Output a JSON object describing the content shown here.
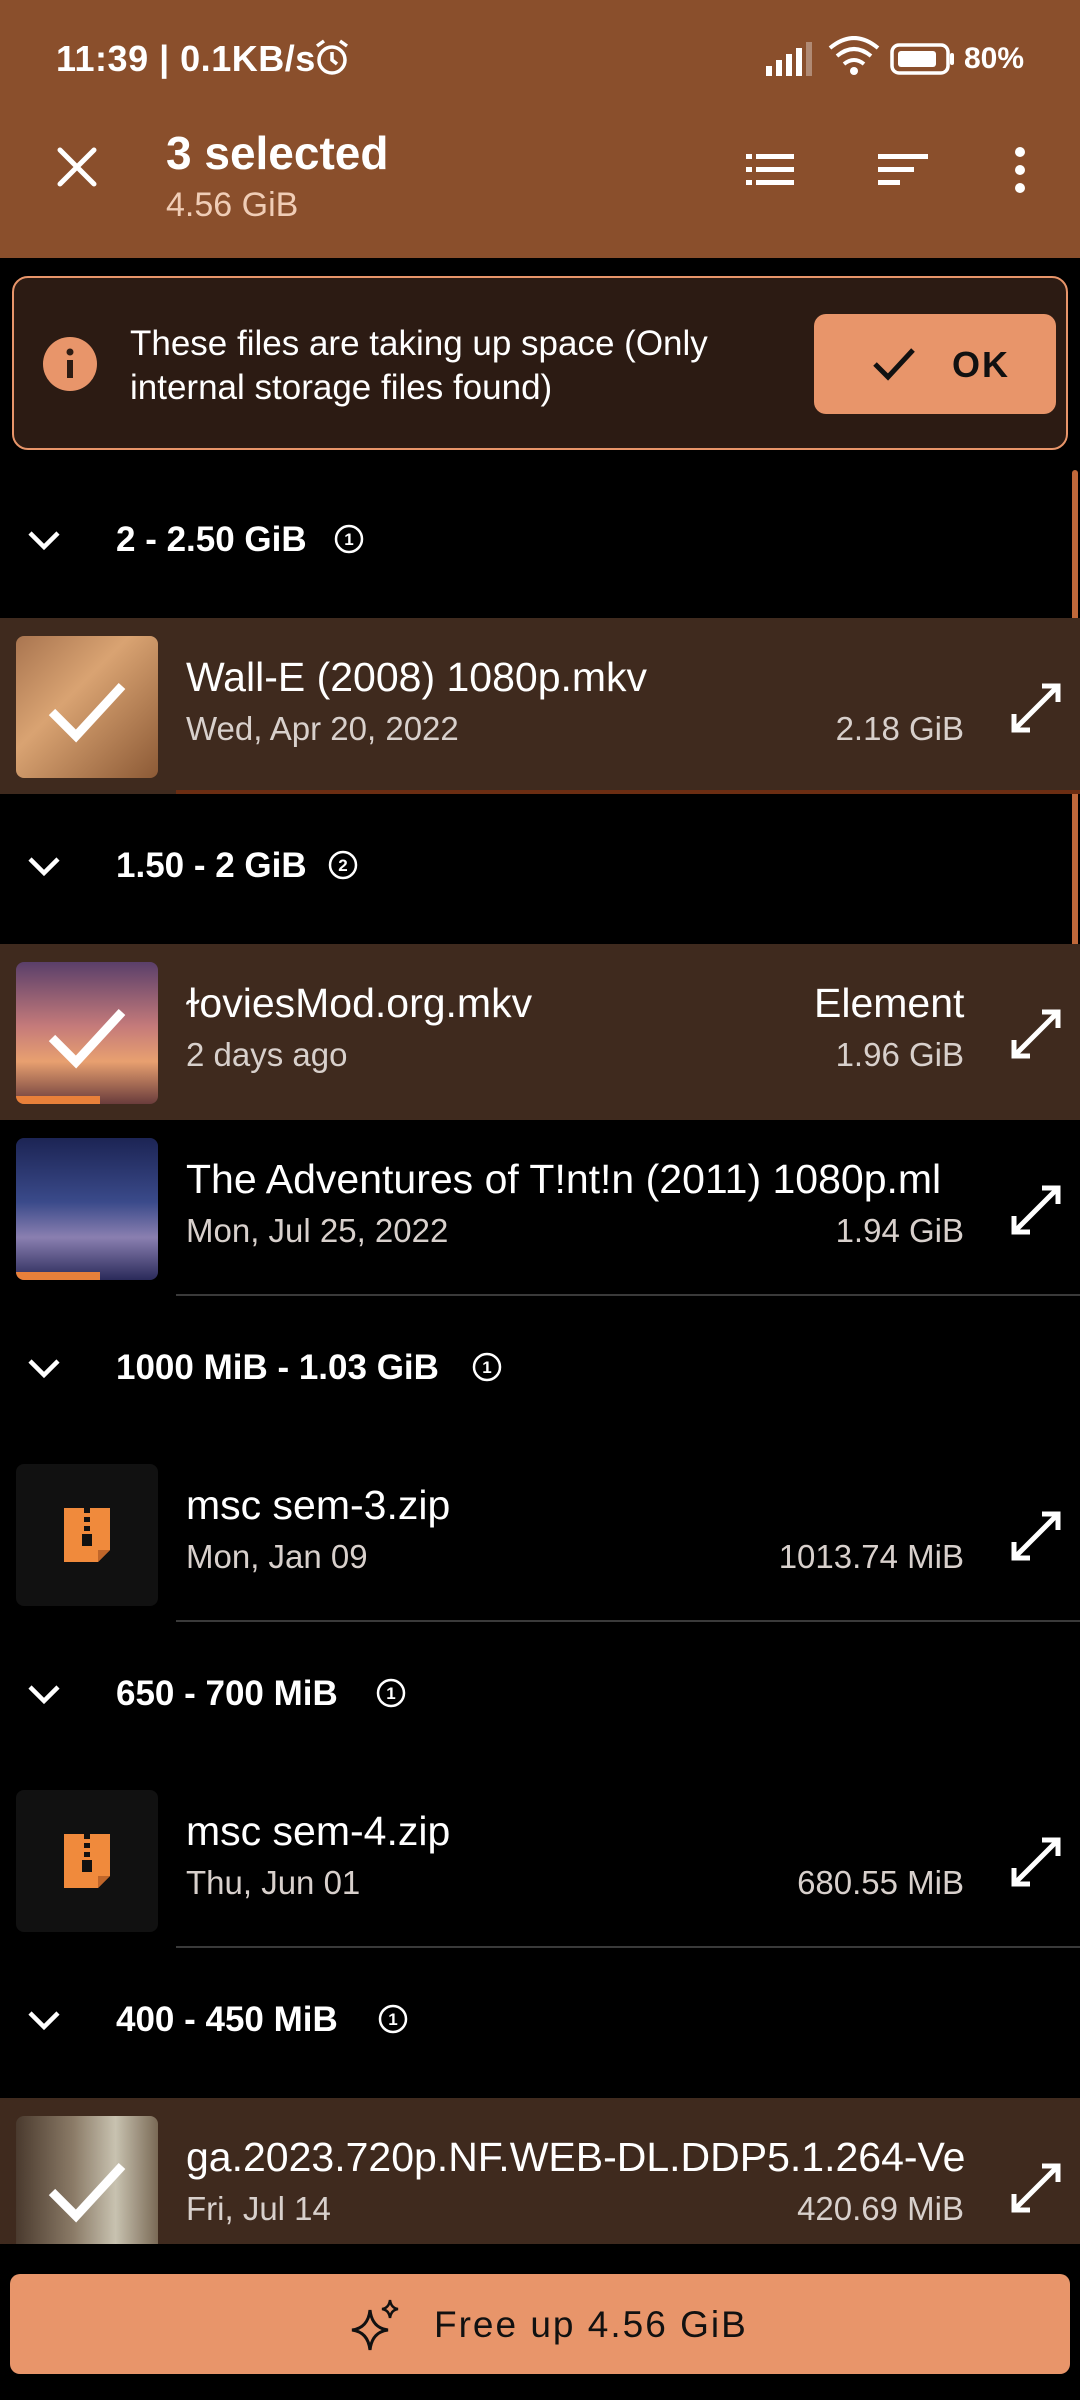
{
  "status_bar": {
    "time_speed": "11:39 | 0.1KB/s",
    "battery": "80%"
  },
  "header": {
    "title": "3 selected",
    "subtitle": "4.56 GiB"
  },
  "banner": {
    "message": "These files are taking up space (Only internal storage files found)",
    "ok_label": "OK"
  },
  "groups": [
    {
      "label": "2 - 2.50 GiB",
      "badge": "1"
    },
    {
      "label": "1.50 - 2 GiB",
      "badge": "2"
    },
    {
      "label": "1000 MiB - 1.03 GiB",
      "badge": "1"
    },
    {
      "label": "650 - 700 MiB",
      "badge": "1"
    },
    {
      "label": "400 - 450 MiB",
      "badge": "1"
    }
  ],
  "files": [
    {
      "name": "Wall-E (2008) 1080p.mkv",
      "date": "Wed, Apr 20, 2022",
      "size": "2.18 GiB",
      "selected": true
    },
    {
      "name": "ɫoviesMod.org.mkv",
      "extra": "Element",
      "date": "2 days ago",
      "size": "1.96 GiB",
      "selected": true
    },
    {
      "name": "The Adventures of T!nt!n (2011) 1080p.ml",
      "date": "Mon, Jul 25, 2022",
      "size": "1.94 GiB",
      "selected": false
    },
    {
      "name": "msc sem-3.zip",
      "date": "Mon, Jan 09",
      "size": "1013.74 MiB",
      "selected": false
    },
    {
      "name": "msc sem-4.zip",
      "date": "Thu, Jun 01",
      "size": "680.55 MiB",
      "selected": false
    },
    {
      "name": "ga.2023.720p.NF.WEB-DL.DDP5.1.264-Ve",
      "date": "Fri, Jul 14",
      "size": "420.69 MiB",
      "selected": true
    }
  ],
  "bottom_action": {
    "label": "Free up 4.56 GiB"
  },
  "colors": {
    "header_bg": "#8a4f2c",
    "accent": "#e8956a",
    "selected_row": "#3f2a1e"
  }
}
